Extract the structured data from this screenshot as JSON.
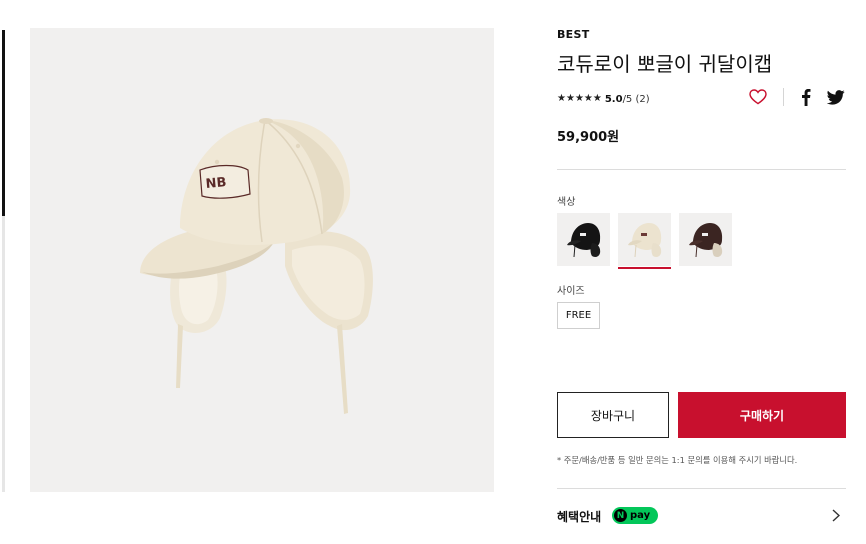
{
  "product": {
    "badge": "BEST",
    "title": "코듀로이 뽀글이 귀달이캡",
    "rating": {
      "stars": 5,
      "score": "5.0",
      "suffix": "/5 (2)"
    },
    "price": "59,900원",
    "image_icon": "cap-product-photo"
  },
  "options": {
    "color_label": "색상",
    "colors": [
      {
        "name": "black",
        "hex": "#111111"
      },
      {
        "name": "ivory",
        "hex": "#ece3cf",
        "selected": true
      },
      {
        "name": "brown",
        "hex": "#3b2522"
      }
    ],
    "size_label": "사이즈",
    "sizes": [
      "FREE"
    ]
  },
  "actions": {
    "cart_label": "장바구니",
    "buy_label": "구매하기",
    "notice": "* 주문/배송/반품 등 일반 문의는 1:1 문의를 이용해 주시기 바랍니다."
  },
  "benefit": {
    "label": "혜택안내",
    "npay_n": "N",
    "npay_text": "pay"
  },
  "colors": {
    "accent": "#c8102e",
    "npay_green": "#03c75a",
    "gallery_bg": "#f1f0ef"
  }
}
